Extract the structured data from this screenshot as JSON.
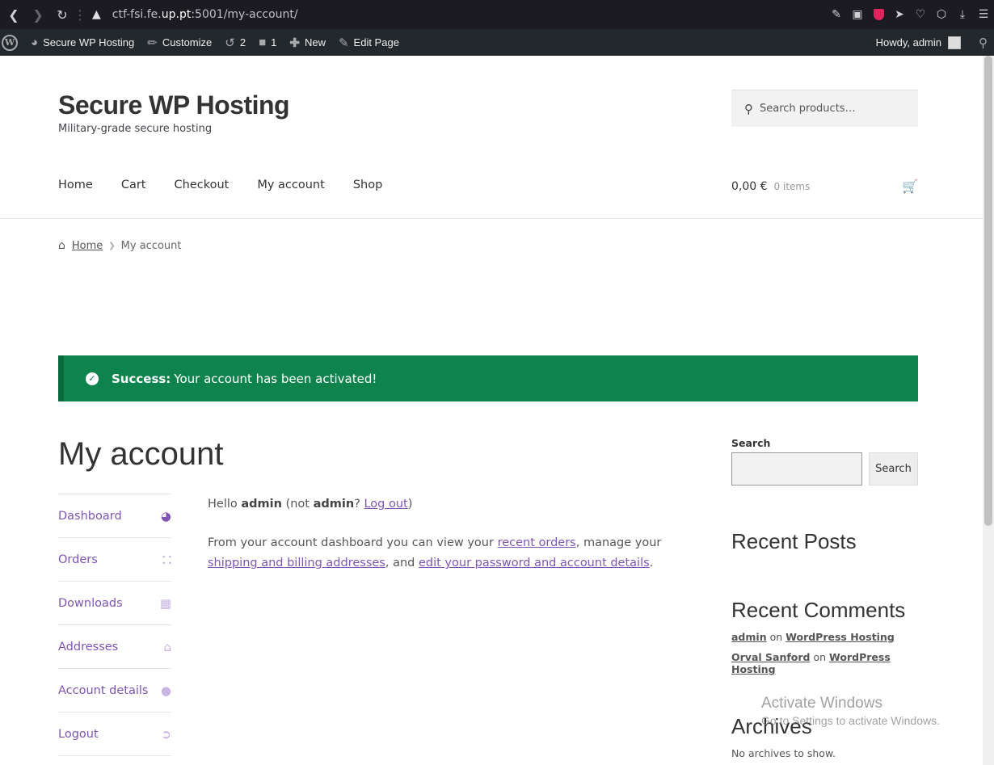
{
  "browser": {
    "url_prefix": "ctf-fsi.fe.",
    "url_host_bold": "up.pt",
    "url_suffix": ":5001/my-account/"
  },
  "admin_bar": {
    "site_name": "Secure WP Hosting",
    "customize": "Customize",
    "updates_count": "2",
    "comments_count": "1",
    "new": "New",
    "edit_page": "Edit Page",
    "howdy": "Howdy, admin"
  },
  "header": {
    "site_title": "Secure WP Hosting",
    "site_description": "Military-grade secure hosting",
    "search_placeholder": "Search products…"
  },
  "nav": {
    "items": [
      "Home",
      "Cart",
      "Checkout",
      "My account",
      "Shop"
    ]
  },
  "cart": {
    "total": "0,00 €",
    "count": "0 items"
  },
  "breadcrumb": {
    "home": "Home",
    "current": "My account"
  },
  "notice": {
    "label": "Success:",
    "message": "Your account has been activated!"
  },
  "page": {
    "title": "My account"
  },
  "account_nav": {
    "items": [
      {
        "label": "Dashboard",
        "icon": "gauge-icon"
      },
      {
        "label": "Orders",
        "icon": "basket-icon"
      },
      {
        "label": "Downloads",
        "icon": "file-icon"
      },
      {
        "label": "Addresses",
        "icon": "home-icon"
      },
      {
        "label": "Account details",
        "icon": "user-icon"
      },
      {
        "label": "Logout",
        "icon": "sign-out-icon"
      }
    ]
  },
  "dashboard": {
    "hello": "Hello",
    "user": "admin",
    "not_text": "(not",
    "user2": "admin",
    "question": "?",
    "logout": "Log out",
    "close_paren": ")",
    "p2_a": "From your account dashboard you can view your",
    "recent_orders": "recent orders",
    "p2_b": ", manage your",
    "addresses": "shipping and billing addresses",
    "p2_c": ", and",
    "account_details": "edit your password and account details",
    "p2_d": "."
  },
  "sidebar": {
    "search_label": "Search",
    "search_button": "Search",
    "recent_posts_title": "Recent Posts",
    "recent_comments_title": "Recent Comments",
    "comments": [
      {
        "author": "admin",
        "on": "on",
        "post": "WordPress Hosting"
      },
      {
        "author": "Orval Sanford",
        "on": "on",
        "post": "WordPress Hosting"
      }
    ],
    "archives_title": "Archives",
    "archives_none": "No archives to show."
  },
  "watermark": {
    "title": "Activate Windows",
    "subtitle": "Go to Settings to activate Windows."
  },
  "colors": {
    "accent": "#7f54b3",
    "success": "#0f834d",
    "admin_bar": "#23282d"
  }
}
